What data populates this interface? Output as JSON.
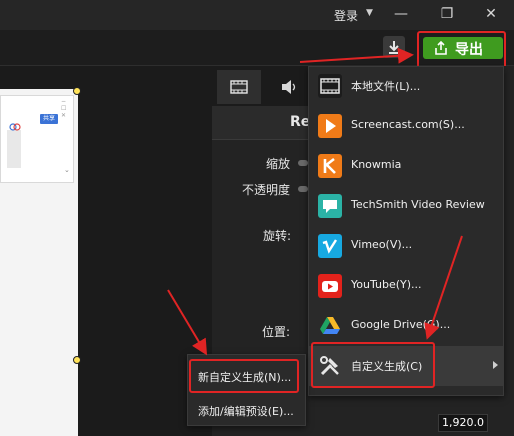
{
  "titlebar": {
    "login_label": "登录",
    "login_caret": "▼",
    "minimize": "—",
    "maximize": "❐",
    "close": "✕"
  },
  "toolbar": {
    "export_label": "导出"
  },
  "canvas": {
    "share_label": "共享"
  },
  "properties": {
    "header_title": "Re",
    "scale_label": "缩放",
    "opacity_label": "不透明度",
    "rotation_label": "旋转:",
    "position_label": "位置:",
    "width_value": "1,920.0"
  },
  "export_menu": {
    "items": [
      {
        "label": "本地文件(L)...",
        "icon": "film-icon"
      },
      {
        "label": "Screencast.com(S)...",
        "icon": "screencast-icon"
      },
      {
        "label": "Knowmia",
        "icon": "knowmia-icon"
      },
      {
        "label": "TechSmith Video Review",
        "icon": "video-review-icon"
      },
      {
        "label": "Vimeo(V)...",
        "icon": "vimeo-icon"
      },
      {
        "label": "YouTube(Y)...",
        "icon": "youtube-icon"
      },
      {
        "label": "Google Drive(G)...",
        "icon": "google-drive-icon"
      },
      {
        "label": "自定义生成(C)",
        "icon": "tools-icon"
      }
    ]
  },
  "submenu": {
    "new_custom": "新自定义生成(N)...",
    "edit_presets": "添加/编辑预设(E)..."
  },
  "colors": {
    "export_green": "#3f9b1f",
    "annotation_red": "#e02424"
  }
}
